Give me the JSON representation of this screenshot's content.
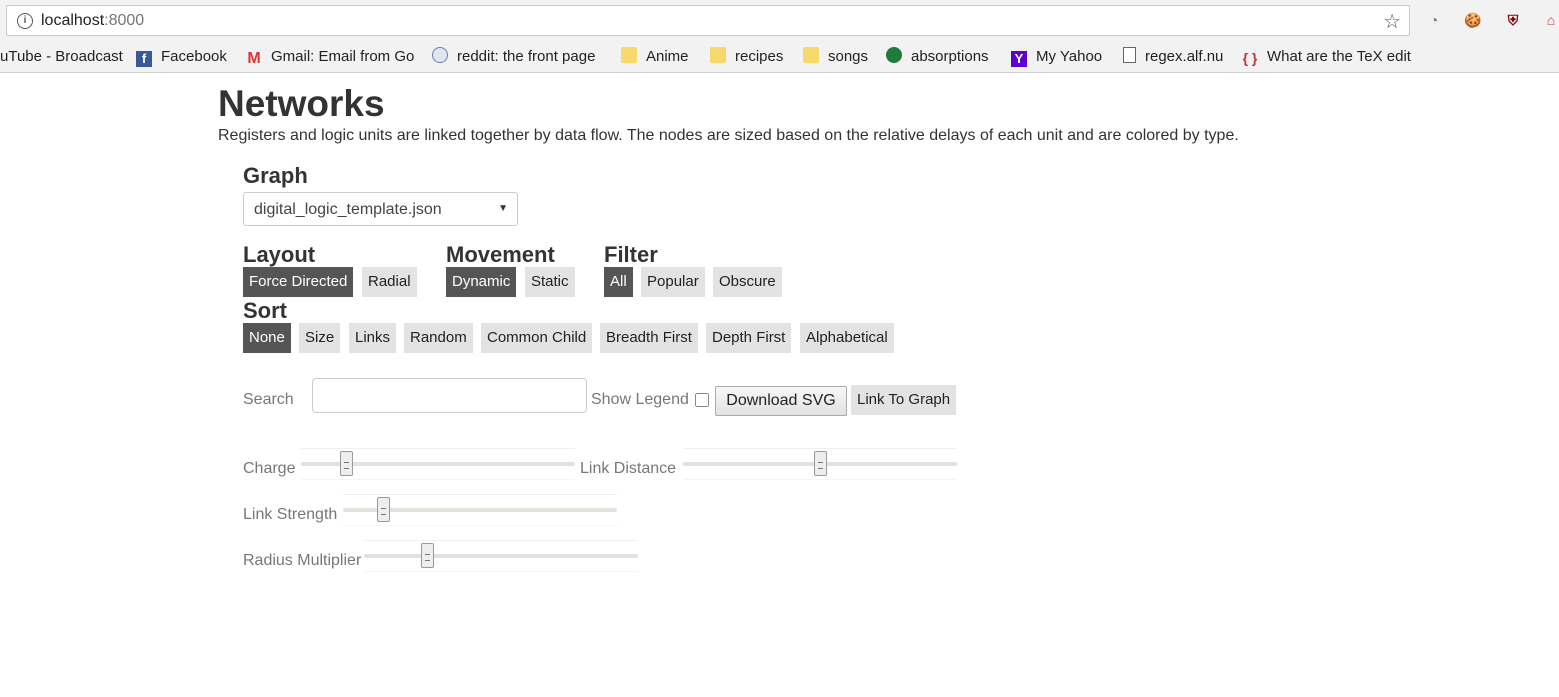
{
  "browser": {
    "url_host": "localhost",
    "url_port": ":8000",
    "bookmarks": [
      "uTube - Broadcast",
      "Facebook",
      "Gmail: Email from Go",
      "reddit: the front page",
      "Anime",
      "recipes",
      "songs",
      "absorptions",
      "My Yahoo",
      "regex.alf.nu",
      "What are the TeX edit"
    ]
  },
  "page": {
    "title": "Networks",
    "description": "Registers and logic units are linked together by data flow. The nodes are sized based on the relative delays of each unit and are colored by type."
  },
  "graph": {
    "label": "Graph",
    "selected": "digital_logic_template.json"
  },
  "layout": {
    "label": "Layout",
    "options": [
      "Force Directed",
      "Radial"
    ],
    "active": "Force Directed"
  },
  "movement": {
    "label": "Movement",
    "options": [
      "Dynamic",
      "Static"
    ],
    "active": "Dynamic"
  },
  "filter": {
    "label": "Filter",
    "options": [
      "All",
      "Popular",
      "Obscure"
    ],
    "active": "All"
  },
  "sort": {
    "label": "Sort",
    "options": [
      "None",
      "Size",
      "Links",
      "Random",
      "Common Child",
      "Breadth First",
      "Depth First",
      "Alphabetical"
    ],
    "active": "None"
  },
  "controls": {
    "search_label": "Search",
    "search_value": "",
    "show_legend_label": "Show Legend",
    "show_legend_checked": false,
    "download_svg_label": "Download SVG",
    "link_to_graph_label": "Link To Graph"
  },
  "sliders": {
    "charge": {
      "label": "Charge",
      "value_fraction": 0.15
    },
    "link_distance": {
      "label": "Link Distance",
      "value_fraction": 0.5
    },
    "link_strength": {
      "label": "Link Strength",
      "value_fraction": 0.13
    },
    "radius_multiplier": {
      "label": "Radius Multiplier",
      "value_fraction": 0.22
    }
  }
}
